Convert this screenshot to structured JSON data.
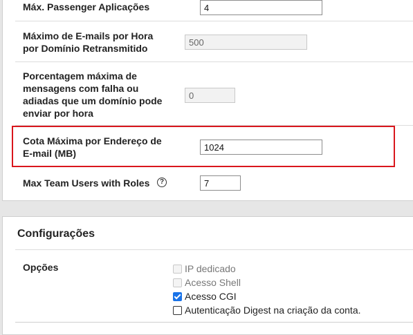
{
  "limits": {
    "passenger_apps": {
      "label": "Máx. Passenger Aplicações",
      "value": "4"
    },
    "max_emails": {
      "label_line1": "Máximo de E-mails por Hora",
      "label_line2": "por Domínio Retransmitido",
      "value": "500"
    },
    "max_failed": {
      "label_line1": "Porcentagem máxima de",
      "label_line2": "mensagens com falha ou",
      "label_line3": "adiadas que um domínio pode",
      "label_line4": "enviar por hora",
      "value": "0"
    },
    "quota": {
      "label_line1": "Cota Máxima por Endereço de",
      "label_line2": "E-mail (MB)",
      "value": "1024"
    },
    "team_users": {
      "label": "Max Team Users with Roles",
      "help_glyph": "?",
      "value": "7"
    }
  },
  "configuracoes": {
    "title": "Configurações",
    "opcoes_label": "Opções",
    "options": [
      {
        "label": "IP dedicado",
        "checked": false,
        "disabled": true
      },
      {
        "label": "Acesso Shell",
        "checked": false,
        "disabled": true
      },
      {
        "label": "Acesso CGI",
        "checked": true,
        "disabled": false
      },
      {
        "label": "Autenticação Digest na criação da conta.",
        "checked": false,
        "disabled": false
      }
    ]
  },
  "colors": {
    "highlight": "#d9161c",
    "checkbox_checked": "#1a73e8"
  }
}
